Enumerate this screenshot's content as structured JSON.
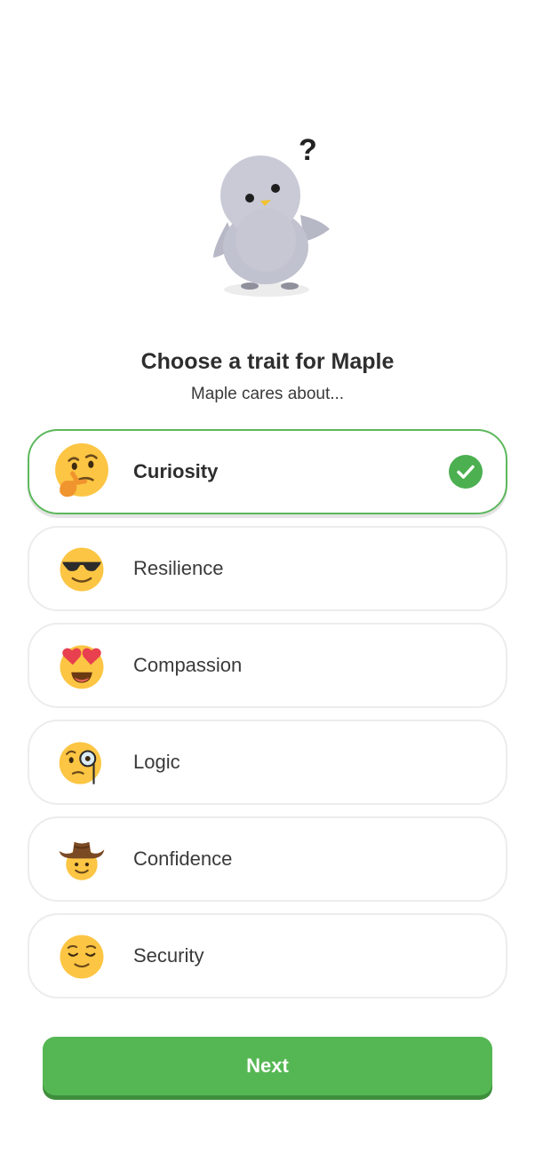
{
  "header": {
    "mascot_icon": "confused-penguin-icon",
    "question_mark": "?",
    "title": "Choose a trait for Maple",
    "subtitle": "Maple cares about..."
  },
  "options": [
    {
      "label": "Curiosity",
      "icon": "thinking-face-icon",
      "selected": true
    },
    {
      "label": "Resilience",
      "icon": "sunglasses-face-icon",
      "selected": false
    },
    {
      "label": "Compassion",
      "icon": "heart-eyes-face-icon",
      "selected": false
    },
    {
      "label": "Logic",
      "icon": "monocle-face-icon",
      "selected": false
    },
    {
      "label": "Confidence",
      "icon": "cowboy-hat-face-icon",
      "selected": false
    },
    {
      "label": "Security",
      "icon": "relieved-face-icon",
      "selected": false
    }
  ],
  "footer": {
    "next_label": "Next"
  },
  "colors": {
    "accent_green": "#55b753",
    "selected_border": "#5cb85c",
    "check_green": "#4caf50"
  }
}
